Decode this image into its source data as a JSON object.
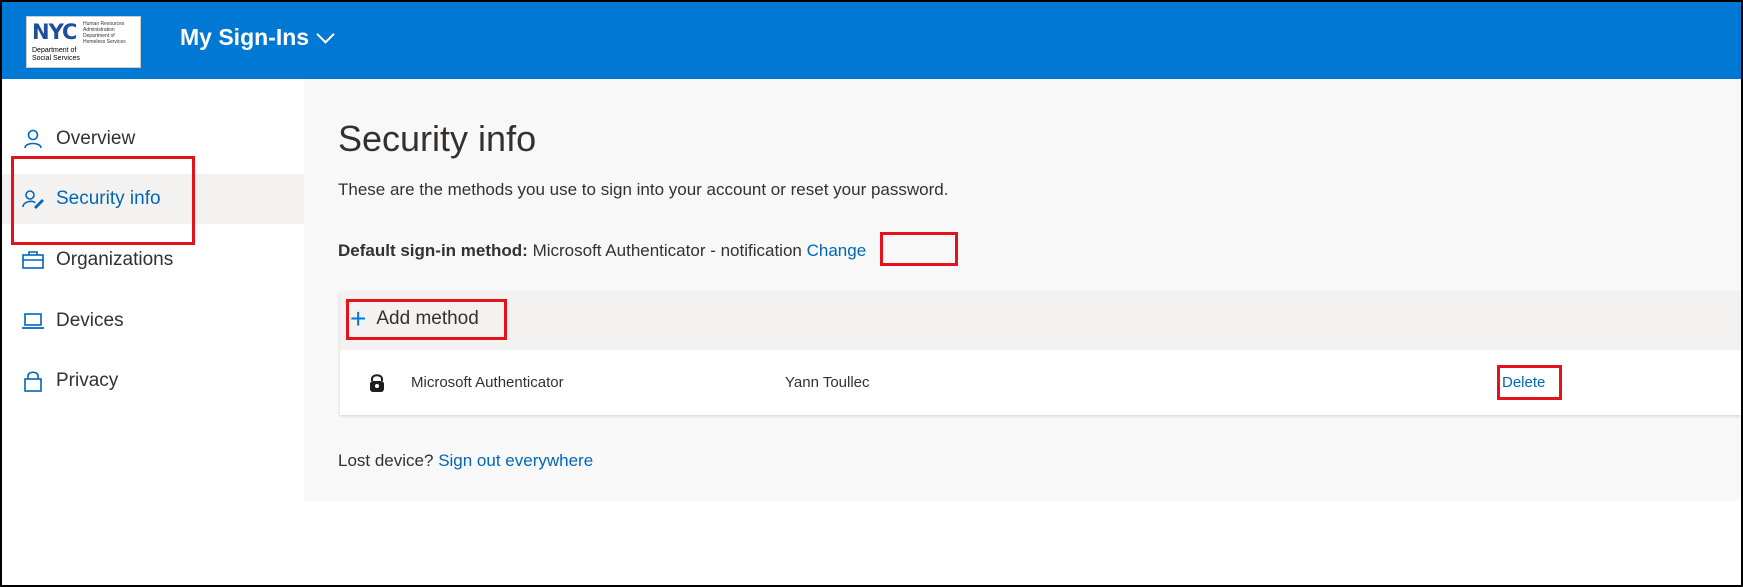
{
  "header": {
    "logo": {
      "nyc": "NYC",
      "dept": "Department of Social Services",
      "small_lines": "Human Resources Administration Department of Homeless Services"
    },
    "app_title": "My Sign-Ins",
    "accent": "#0078d4"
  },
  "sidebar": {
    "items": [
      {
        "label": "Overview",
        "icon": "person-icon"
      },
      {
        "label": "Security info",
        "icon": "security-info-icon",
        "active": true
      },
      {
        "label": "Organizations",
        "icon": "briefcase-icon"
      },
      {
        "label": "Devices",
        "icon": "laptop-icon"
      },
      {
        "label": "Privacy",
        "icon": "lock-icon"
      }
    ]
  },
  "main": {
    "title": "Security info",
    "description": "These are the methods you use to sign into your account or reset your password.",
    "default_label": "Default sign-in method:",
    "default_value": "Microsoft Authenticator - notification",
    "change_link": "Change",
    "add_method": "Add method",
    "methods": [
      {
        "name": "Microsoft Authenticator",
        "user": "Yann Toullec",
        "action": "Delete",
        "icon": "authenticator-lock-icon"
      }
    ],
    "lost_prefix": "Lost device?",
    "lost_link": "Sign out everywhere"
  },
  "colors": {
    "link": "#0067b8",
    "highlight": "#e3131b"
  }
}
